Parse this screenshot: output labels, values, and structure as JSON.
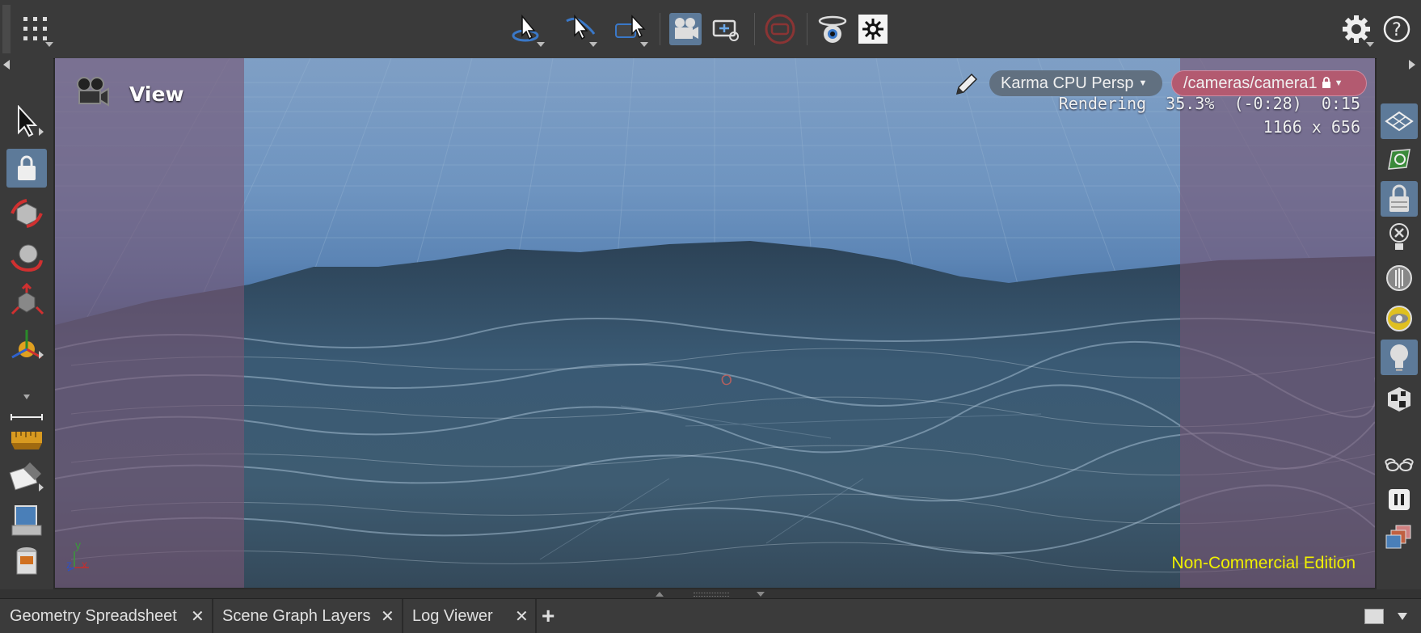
{
  "toolbar": {
    "tools": [
      {
        "name": "view-tool-icon"
      },
      {
        "name": "select-tool-icon"
      },
      {
        "name": "pose-tool-icon"
      },
      {
        "name": "camera-menu-icon"
      },
      {
        "name": "frame-selection-icon"
      },
      {
        "name": "stop-render-icon"
      },
      {
        "name": "light-link-icon"
      },
      {
        "name": "display-options-icon"
      }
    ],
    "settings_icon": "gear-icon",
    "help_icon": "help-icon"
  },
  "viewport": {
    "title": "View",
    "renderer": "Karma CPU  Persp",
    "camera_path": "/cameras/camera1",
    "render_status": "Rendering  35.3%  (-0:28)  0:15",
    "render_resolution": "1166 x 656",
    "edition": "Non-Commercial Edition",
    "axis_labels": {
      "y": "y",
      "z": "z",
      "x": "x"
    },
    "origin_label": "O"
  },
  "tabs": [
    {
      "label": "Geometry Spreadsheet"
    },
    {
      "label": "Scene Graph Layers"
    },
    {
      "label": "Log Viewer"
    }
  ],
  "colors": {
    "accent": "#5d7a99",
    "renderer_pill": "#617080",
    "camera_pill": "#b35a70",
    "edition_text": "#f0f000"
  }
}
